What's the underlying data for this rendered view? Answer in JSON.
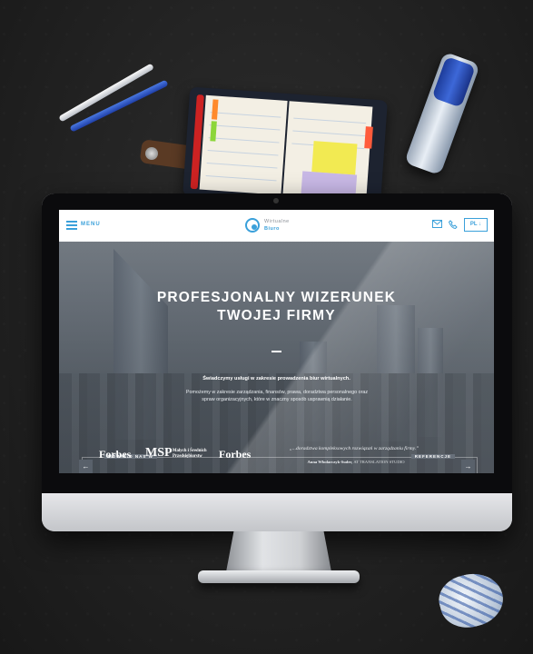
{
  "nav": {
    "menu_label": "MENU",
    "logo_line1": "Wirtualne",
    "logo_line2": "Biuro",
    "lang_label": "PL"
  },
  "hero": {
    "title_line1": "PROFESJONALNY WIZERUNEK",
    "title_line2": "TWOJEJ FIRMY",
    "lead": "Świadczymy usługi w zakresie prowadzenia biur wirtualnych.",
    "body_line1": "Pomożemy w zakresie zarządzania, finansów, prawa, doradztwa personalnego oraz",
    "body_line2": "spraw organizacyjnych, które w znaczny sposób usprawnią działanie."
  },
  "press": {
    "label": "MOWIA O NAS W",
    "logos": [
      "Forbes",
      "MSP",
      "Małych i Średnich Przedsiębiorstw",
      "Forbes"
    ]
  },
  "references": {
    "label": "REFERENCJE",
    "quote": "„...doradztwa kompleksowych rozwiązań w zarządzaniu firmy.”",
    "author": "Anna Włodarczyk-Suder,",
    "company": "AT TRANSLATION STUDIO"
  },
  "colors": {
    "accent": "#3aa0da",
    "background": "#222222"
  },
  "icons": [
    "menu-icon",
    "mail-icon",
    "phone-icon",
    "arrow-down-icon",
    "arrow-left-icon",
    "arrow-right-icon"
  ]
}
